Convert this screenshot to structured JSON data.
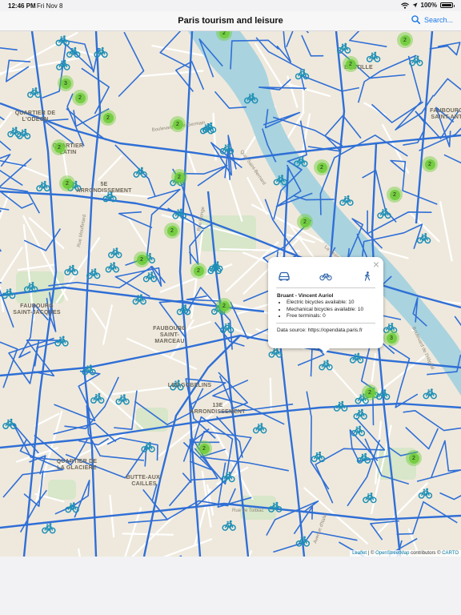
{
  "status_bar": {
    "time": "12:46 PM",
    "date": "Fri Nov 8",
    "battery": "100%"
  },
  "nav": {
    "title": "Paris tourism and leisure",
    "search_label": "Search..."
  },
  "map": {
    "place_labels": [
      "QUARTIER DE\nL'ODÉON",
      "QUARTIER\nLATIN",
      "5E\nARRONDISSEMENT",
      "FAUBOURG\nSAINT-JACQUES",
      "FAUBOURG\nSAINT-\nMARCEAU",
      "LES GOBELINS",
      "13E\nARRONDISSEMENT",
      "QUARTIER DE\nLA GLACIÈRE",
      "BUTTE-AUX-\nCAILLES",
      "BASTILLE",
      "FAUBOURG\nSAINT-ANT"
    ],
    "street_labels": [
      "Boulevard Saint-Germain",
      "Rue Monge",
      "Quai Saint-Bernard",
      "La Seine",
      "Boulevard de l'Hôpital",
      "Rue de Tolbiac",
      "Avenue d'Italie",
      "Rue Mouffetard"
    ],
    "clusters": [
      {
        "count": "2"
      },
      {
        "count": "2"
      },
      {
        "count": "3"
      },
      {
        "count": "2"
      },
      {
        "count": "2"
      },
      {
        "count": "2"
      },
      {
        "count": "2"
      },
      {
        "count": "2"
      },
      {
        "count": "2"
      },
      {
        "count": "2"
      },
      {
        "count": "2"
      },
      {
        "count": "2"
      },
      {
        "count": "2"
      },
      {
        "count": "2"
      },
      {
        "count": "2"
      },
      {
        "count": "2"
      },
      {
        "count": "2"
      },
      {
        "count": "2"
      },
      {
        "count": "3"
      },
      {
        "count": "2"
      },
      {
        "count": "2"
      },
      {
        "count": "2"
      }
    ],
    "bike_icon": "bicycle-icon",
    "bike_count": 70,
    "colors": {
      "bike_lane": "#2f6fd6",
      "cluster": "#6ecc39",
      "river": "#a9d3df",
      "park": "#d8e6c9",
      "land": "#efe9dd"
    }
  },
  "popup": {
    "station": "Bruant - Vincent Auriol",
    "details": [
      "Electric bicycles available: 10",
      "Mechanical bicycles available: 10",
      "Free terminals: 0"
    ],
    "source": "Data source: https://opendata.paris.fr",
    "modes": [
      "car-icon",
      "bicycle-icon",
      "walking-icon"
    ]
  },
  "attribution": {
    "leaflet": "Leaflet",
    "sep": " | © ",
    "osm": "OpenStreetMap",
    "mid": " contributors © ",
    "carto": "CARTO"
  }
}
